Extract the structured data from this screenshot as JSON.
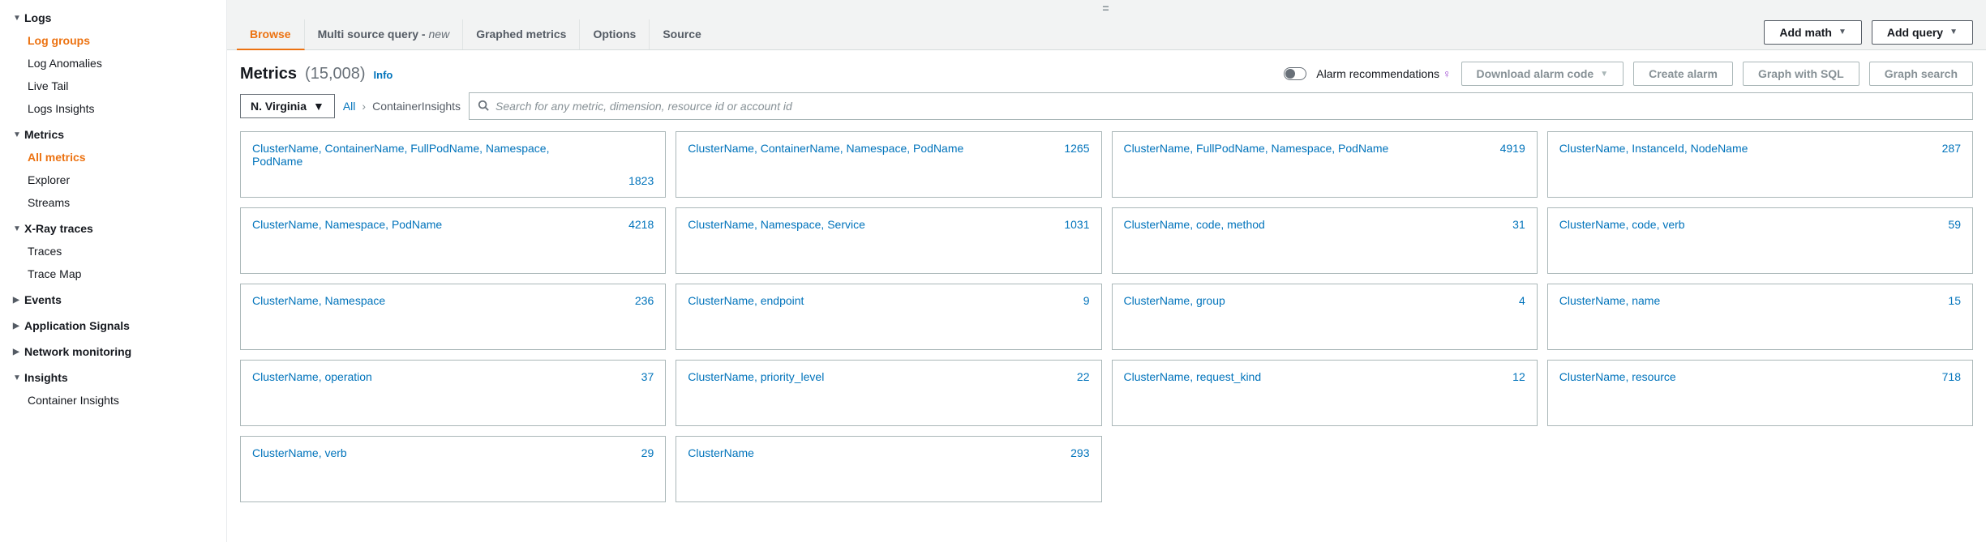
{
  "sidebar": {
    "sections": [
      {
        "label": "Logs",
        "expanded": true,
        "items": [
          {
            "label": "Log groups",
            "active": true
          },
          {
            "label": "Log Anomalies"
          },
          {
            "label": "Live Tail"
          },
          {
            "label": "Logs Insights"
          }
        ]
      },
      {
        "label": "Metrics",
        "expanded": true,
        "items": [
          {
            "label": "All metrics",
            "active": true
          },
          {
            "label": "Explorer"
          },
          {
            "label": "Streams"
          }
        ]
      },
      {
        "label": "X-Ray traces",
        "expanded": true,
        "items": [
          {
            "label": "Traces"
          },
          {
            "label": "Trace Map"
          }
        ]
      },
      {
        "label": "Events",
        "expanded": false
      },
      {
        "label": "Application Signals",
        "expanded": false
      },
      {
        "label": "Network monitoring",
        "expanded": false
      },
      {
        "label": "Insights",
        "expanded": true,
        "items": [
          {
            "label": "Container Insights"
          }
        ]
      }
    ]
  },
  "tabs": {
    "browse": "Browse",
    "multi_source": "Multi source query - ",
    "multi_source_new": "new",
    "graphed": "Graphed metrics",
    "options": "Options",
    "source": "Source"
  },
  "actions": {
    "add_math": "Add math",
    "add_query": "Add query"
  },
  "heading": {
    "title": "Metrics",
    "count": "(15,008)",
    "info": "Info",
    "alarm_recs": "Alarm recommendations",
    "download_code": "Download alarm code",
    "create_alarm": "Create alarm",
    "graph_sql": "Graph with SQL",
    "graph_search": "Graph search"
  },
  "filter": {
    "region": "N. Virginia",
    "bc_all": "All",
    "bc_current": "ContainerInsights",
    "search_placeholder": "Search for any metric, dimension, resource id or account id"
  },
  "cards": [
    {
      "title": "ClusterName, ContainerName, FullPodName, Namespace, PodName",
      "count": "1823"
    },
    {
      "title": "ClusterName, ContainerName, Namespace, PodName",
      "count": "1265"
    },
    {
      "title": "ClusterName, FullPodName, Namespace, PodName",
      "count": "4919"
    },
    {
      "title": "ClusterName, InstanceId, NodeName",
      "count": "287"
    },
    {
      "title": "ClusterName, Namespace, PodName",
      "count": "4218"
    },
    {
      "title": "ClusterName, Namespace, Service",
      "count": "1031"
    },
    {
      "title": "ClusterName, code, method",
      "count": "31"
    },
    {
      "title": "ClusterName, code, verb",
      "count": "59"
    },
    {
      "title": "ClusterName, Namespace",
      "count": "236"
    },
    {
      "title": "ClusterName, endpoint",
      "count": "9"
    },
    {
      "title": "ClusterName, group",
      "count": "4"
    },
    {
      "title": "ClusterName, name",
      "count": "15"
    },
    {
      "title": "ClusterName, operation",
      "count": "37"
    },
    {
      "title": "ClusterName, priority_level",
      "count": "22"
    },
    {
      "title": "ClusterName, request_kind",
      "count": "12"
    },
    {
      "title": "ClusterName, resource",
      "count": "718"
    },
    {
      "title": "ClusterName, verb",
      "count": "29"
    },
    {
      "title": "ClusterName",
      "count": "293"
    }
  ]
}
